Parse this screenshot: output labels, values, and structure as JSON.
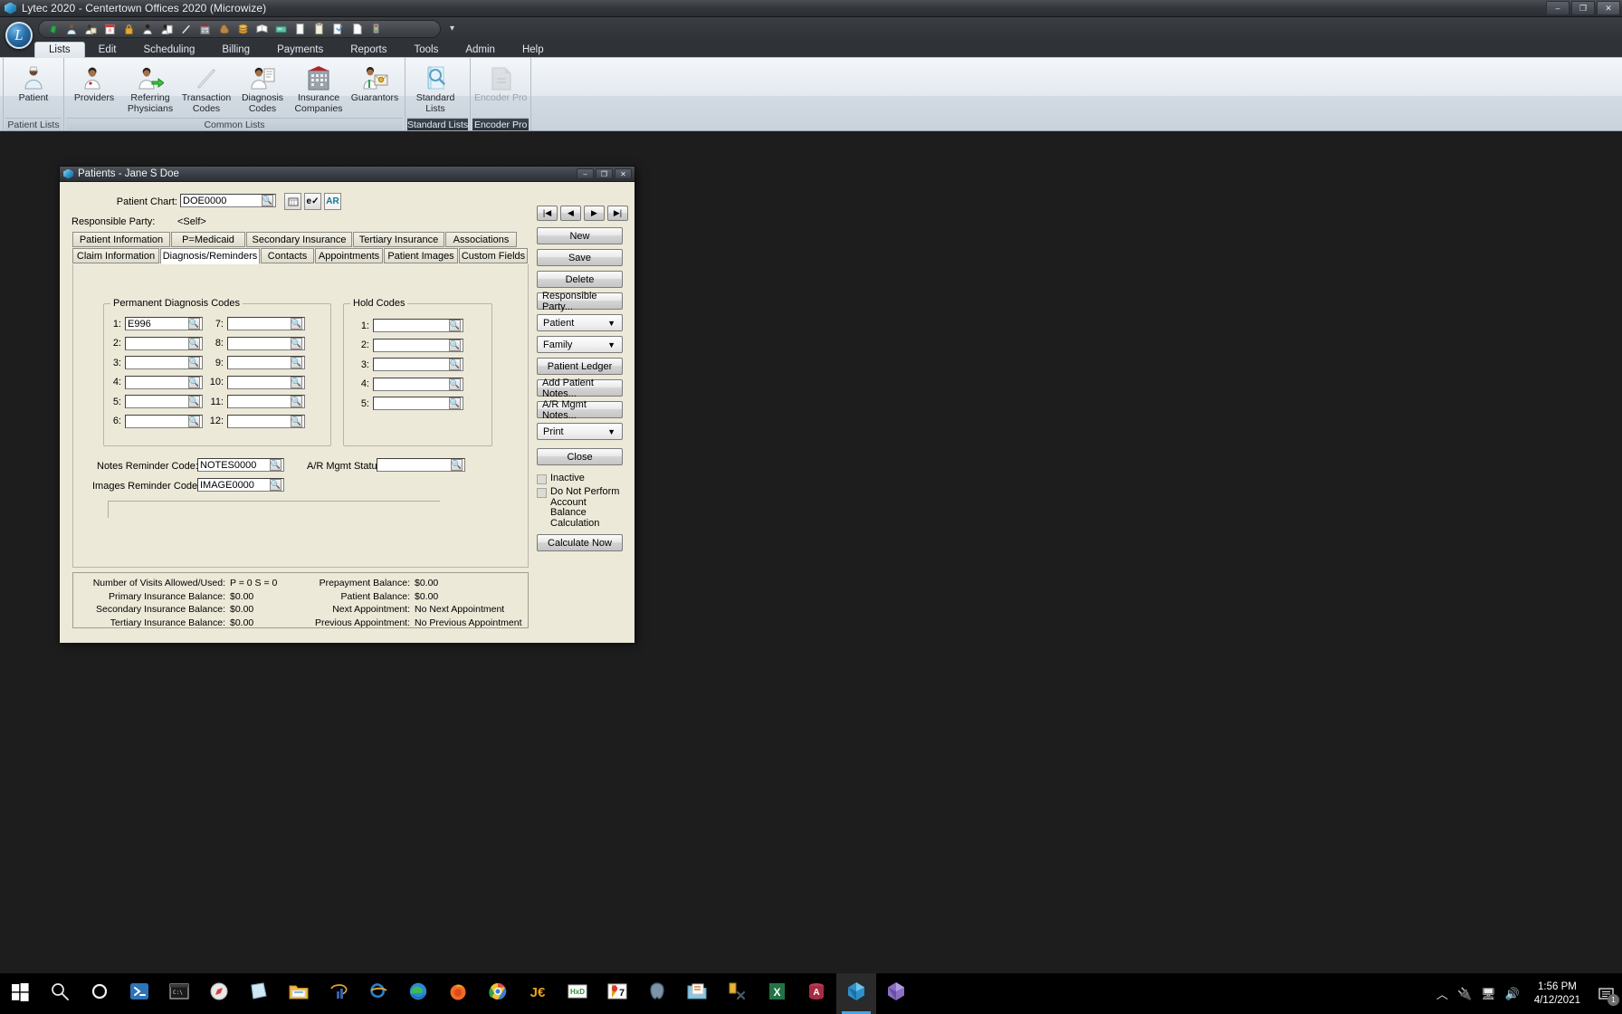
{
  "app": {
    "title": "Lytec 2020 - Centertown Offices 2020 (Microwize)",
    "window_buttons": [
      "–",
      "❐",
      "✕"
    ],
    "orb_letter": "L",
    "quick_access_overflow": "▾",
    "quick_access_icons": [
      "money-icon",
      "patient-white-icon",
      "patient-card-icon",
      "calendar-icon",
      "lock-icon",
      "provider-icon",
      "provider-doc-icon",
      "pencil-icon",
      "building-icon",
      "money-bag-icon",
      "coins-icon",
      "ledger-icon",
      "check-icon",
      "document-icon",
      "clipboard-icon",
      "reports-icon",
      "page-icon",
      "traffic-icon"
    ],
    "tabs": [
      {
        "label": "Lists",
        "active": true
      },
      {
        "label": "Edit",
        "active": false
      },
      {
        "label": "Scheduling",
        "active": false
      },
      {
        "label": "Billing",
        "active": false
      },
      {
        "label": "Payments",
        "active": false
      },
      {
        "label": "Reports",
        "active": false
      },
      {
        "label": "Tools",
        "active": false
      },
      {
        "label": "Admin",
        "active": false
      },
      {
        "label": "Help",
        "active": false
      }
    ],
    "ribbon_groups": [
      {
        "label": "Patient Lists",
        "dark": false,
        "items": [
          {
            "label": "Patient",
            "caret": "▾",
            "icon": "patient-icon",
            "disabled": false
          }
        ]
      },
      {
        "label": "Common Lists",
        "dark": false,
        "items": [
          {
            "label": "Providers",
            "caret": "",
            "icon": "provider-icon",
            "disabled": false
          },
          {
            "label": "Referring Physicians",
            "caret": "",
            "icon": "referring-physician-icon",
            "disabled": false
          },
          {
            "label": "Transaction Codes",
            "caret": "",
            "icon": "transaction-code-icon",
            "disabled": false
          },
          {
            "label": "Diagnosis Codes",
            "caret": "",
            "icon": "diagnosis-code-icon",
            "disabled": false
          },
          {
            "label": "Insurance Companies",
            "caret": "",
            "icon": "insurance-company-icon",
            "disabled": false
          },
          {
            "label": "Guarantors",
            "caret": "",
            "icon": "guarantor-icon",
            "disabled": false
          }
        ]
      },
      {
        "label": "Standard Lists",
        "dark": true,
        "items": [
          {
            "label": "Standard Lists",
            "caret": "▾",
            "icon": "standard-lists-icon",
            "disabled": false
          }
        ]
      },
      {
        "label": "Encoder Pro",
        "dark": true,
        "items": [
          {
            "label": "Encoder Pro",
            "caret": "",
            "icon": "encoder-pro-icon",
            "disabled": true
          }
        ]
      }
    ]
  },
  "dialog": {
    "title": "Patients - Jane S Doe",
    "window_buttons": [
      "–",
      "❐",
      "✕"
    ],
    "patient_chart_label": "Patient Chart:",
    "patient_chart_value": "DOE0000",
    "chart_tool_icons": [
      "eligibility-icon",
      "eligibility-check-icon",
      "ar-icon"
    ],
    "ar_icon_text": "AR",
    "responsible_party_label": "Responsible Party:",
    "responsible_party_value": "<Self>",
    "tabs_row1": [
      {
        "label": "Patient Information",
        "active": false
      },
      {
        "label": "P=Medicaid",
        "active": false
      },
      {
        "label": "Secondary Insurance",
        "active": false
      },
      {
        "label": "Tertiary Insurance",
        "active": false
      },
      {
        "label": "Associations",
        "active": false
      }
    ],
    "tabs_row2": [
      {
        "label": "Claim Information",
        "active": false
      },
      {
        "label": "Diagnosis/Reminders",
        "active": true
      },
      {
        "label": "Contacts",
        "active": false
      },
      {
        "label": "Appointments",
        "active": false
      },
      {
        "label": "Patient Images",
        "active": false
      },
      {
        "label": "Custom Fields",
        "active": false
      }
    ],
    "permanent_diagnosis_caption": "Permanent Diagnosis Codes",
    "diagnosis_left": [
      {
        "n": "1:",
        "value": "E996"
      },
      {
        "n": "2:",
        "value": ""
      },
      {
        "n": "3:",
        "value": ""
      },
      {
        "n": "4:",
        "value": ""
      },
      {
        "n": "5:",
        "value": ""
      },
      {
        "n": "6:",
        "value": ""
      }
    ],
    "diagnosis_right": [
      {
        "n": "7:",
        "value": ""
      },
      {
        "n": "8:",
        "value": ""
      },
      {
        "n": "9:",
        "value": ""
      },
      {
        "n": "10:",
        "value": ""
      },
      {
        "n": "11:",
        "value": ""
      },
      {
        "n": "12:",
        "value": ""
      }
    ],
    "hold_codes_caption": "Hold Codes",
    "hold_codes": [
      {
        "n": "1:",
        "value": ""
      },
      {
        "n": "2:",
        "value": ""
      },
      {
        "n": "3:",
        "value": ""
      },
      {
        "n": "4:",
        "value": ""
      },
      {
        "n": "5:",
        "value": ""
      }
    ],
    "notes_reminder_label": "Notes Reminder Code:",
    "notes_reminder_value": "NOTES0000",
    "images_reminder_label": "Images Reminder Code:",
    "images_reminder_value": "IMAGE0000",
    "ar_mgmt_status_label": "A/R Mgmt Status:",
    "ar_mgmt_status_value": "",
    "memo_value": "",
    "nav_buttons": [
      "|◀",
      "◀",
      "▶",
      "▶|"
    ],
    "buttons": [
      {
        "name": "new",
        "label": "New"
      },
      {
        "name": "save",
        "label": "Save"
      },
      {
        "name": "delete",
        "label": "Delete"
      },
      {
        "name": "responsible-party",
        "label": "Responsible Party..."
      }
    ],
    "dropdowns": [
      {
        "name": "patient",
        "label": "Patient",
        "arrow": "▼"
      },
      {
        "name": "family",
        "label": "Family",
        "arrow": "▼"
      }
    ],
    "buttons2": [
      {
        "name": "patient-ledger",
        "label": "Patient Ledger"
      },
      {
        "name": "add-patient-notes",
        "label": "Add Patient Notes..."
      },
      {
        "name": "ar-mgmt-notes",
        "label": "A/R Mgmt Notes..."
      }
    ],
    "print_dropdown": {
      "label": "Print",
      "arrow": "▼"
    },
    "close_button": "Close",
    "inactive_checkbox": "Inactive",
    "do_not_perform_checkbox": "Do Not Perform Account Balance Calculation",
    "calculate_now_button": "Calculate Now",
    "status_left": [
      {
        "k": "Number of Visits Allowed/Used:",
        "v": "P = 0  S = 0"
      },
      {
        "k": "Primary Insurance Balance:",
        "v": "$0.00"
      },
      {
        "k": "Secondary Insurance Balance:",
        "v": "$0.00"
      },
      {
        "k": "Tertiary Insurance Balance:",
        "v": "$0.00"
      }
    ],
    "status_right": [
      {
        "k": "Prepayment Balance:",
        "v": "$0.00"
      },
      {
        "k": "Patient Balance:",
        "v": "$0.00"
      },
      {
        "k": "Next Appointment:",
        "v": "No Next Appointment"
      },
      {
        "k": "Previous Appointment:",
        "v": "No Previous Appointment"
      }
    ]
  },
  "taskbar": {
    "items": [
      {
        "name": "start-button",
        "icon": "windows-logo-icon",
        "active": false
      },
      {
        "name": "search-button",
        "icon": "search-icon",
        "active": false
      },
      {
        "name": "cortana-button",
        "icon": "circle-icon",
        "active": false
      },
      {
        "name": "powershell-button",
        "icon": "powershell-icon",
        "active": false
      },
      {
        "name": "command-prompt-button",
        "icon": "command-prompt-icon",
        "active": false
      },
      {
        "name": "safari-button",
        "icon": "compass-icon",
        "active": false
      },
      {
        "name": "notes-button",
        "icon": "note-icon",
        "active": false
      },
      {
        "name": "file-explorer-button",
        "icon": "folder-icon",
        "active": false
      },
      {
        "name": "lasso-button",
        "icon": "lasso-icon",
        "active": false
      },
      {
        "name": "internet-explorer-button",
        "icon": "internet-explorer-icon",
        "active": false
      },
      {
        "name": "edge-button",
        "icon": "edge-icon",
        "active": false
      },
      {
        "name": "firefox-button",
        "icon": "firefox-icon",
        "active": false
      },
      {
        "name": "chrome-button",
        "icon": "chrome-icon",
        "active": false
      },
      {
        "name": "jetbrains-button",
        "icon": "jetbrains-icon",
        "active": false
      },
      {
        "name": "hxd-button",
        "icon": "hxd-icon",
        "active": false
      },
      {
        "name": "7zip-button",
        "icon": "7zip-icon",
        "active": false
      },
      {
        "name": "postgresql-button",
        "icon": "postgresql-icon",
        "active": false
      },
      {
        "name": "files-button",
        "icon": "files-icon",
        "active": false
      },
      {
        "name": "tools-button",
        "icon": "tools-icon",
        "active": false
      },
      {
        "name": "excel-button",
        "icon": "excel-icon",
        "active": false
      },
      {
        "name": "access-button",
        "icon": "access-icon",
        "active": false
      },
      {
        "name": "lytec-button",
        "icon": "lytec-icon",
        "active": true
      },
      {
        "name": "app-button",
        "icon": "purple-cube-icon",
        "active": false
      }
    ],
    "tray": {
      "chevron": "︿",
      "icons": [
        "pen-battery-icon",
        "network-icon",
        "volume-icon"
      ],
      "time": "1:56 PM",
      "date": "4/12/2021",
      "notification_count": "1"
    }
  }
}
